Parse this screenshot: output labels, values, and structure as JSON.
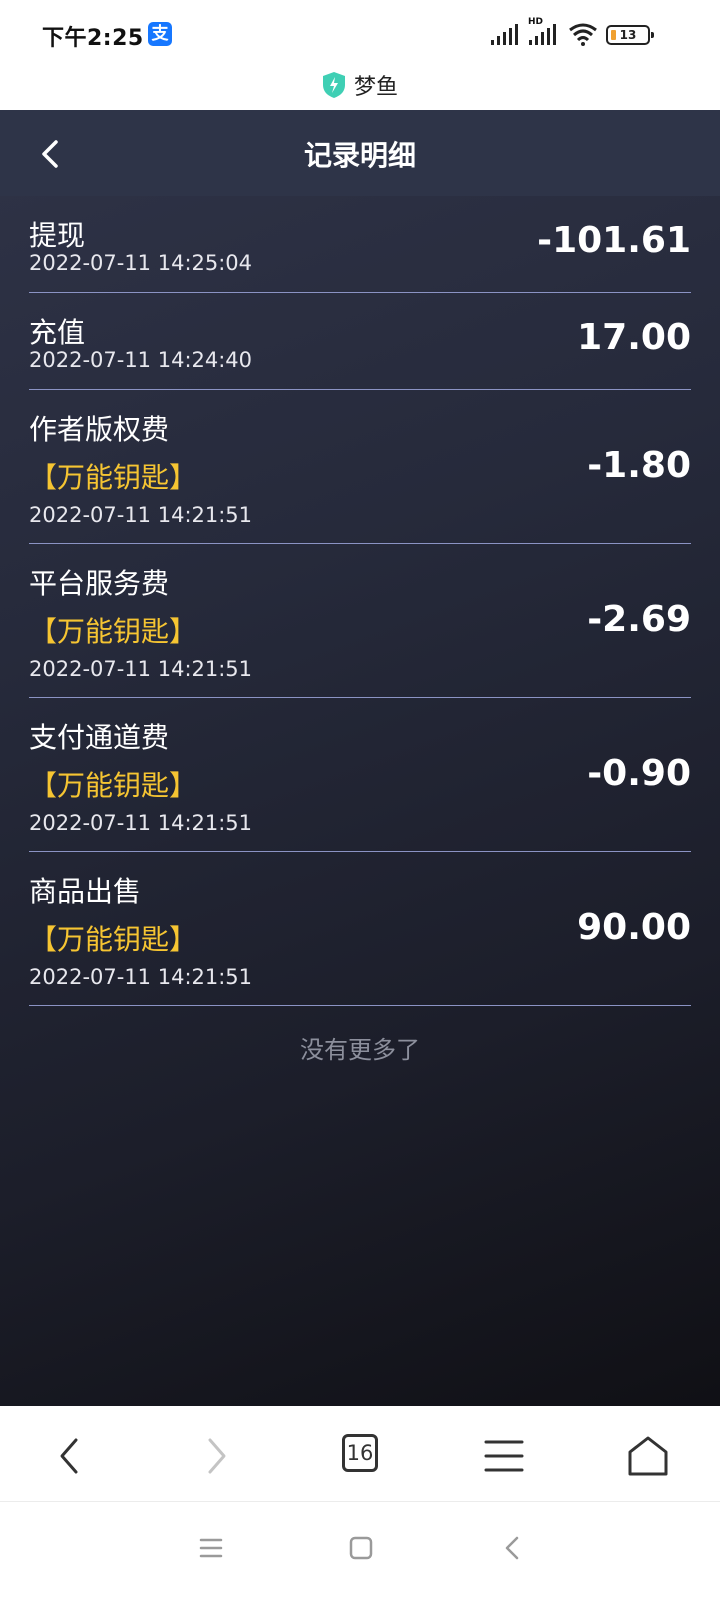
{
  "status_bar": {
    "time": "下午2:25",
    "app_icon": "支",
    "hd_label": "HD",
    "battery": "13"
  },
  "site": {
    "name": "梦鱼",
    "icon": "shield-icon",
    "accent": "#3fcfb4"
  },
  "page": {
    "title": "记录明细",
    "back_icon": "chevron-left-icon"
  },
  "records": [
    {
      "title": "提现",
      "tag": "",
      "time": "2022-07-11 14:25:04",
      "amount": "-101.61"
    },
    {
      "title": "充值",
      "tag": "",
      "time": "2022-07-11 14:24:40",
      "amount": "17.00"
    },
    {
      "title": "作者版权费",
      "tag": "【万能钥匙】",
      "time": "2022-07-11 14:21:51",
      "amount": "-1.80"
    },
    {
      "title": "平台服务费",
      "tag": "【万能钥匙】",
      "time": "2022-07-11 14:21:51",
      "amount": "-2.69"
    },
    {
      "title": "支付通道费",
      "tag": "【万能钥匙】",
      "time": "2022-07-11 14:21:51",
      "amount": "-0.90"
    },
    {
      "title": "商品出售",
      "tag": "【万能钥匙】",
      "time": "2022-07-11 14:21:51",
      "amount": "90.00"
    }
  ],
  "footer_text": "没有更多了",
  "browser_toolbar": {
    "tabs_count": "16",
    "icons": [
      "back-icon",
      "forward-icon",
      "tabs-icon",
      "menu-icon",
      "home-icon"
    ]
  },
  "colors": {
    "tag": "#f6c532",
    "divider": "#8b93c4",
    "nav_bg": "#2e3448"
  }
}
